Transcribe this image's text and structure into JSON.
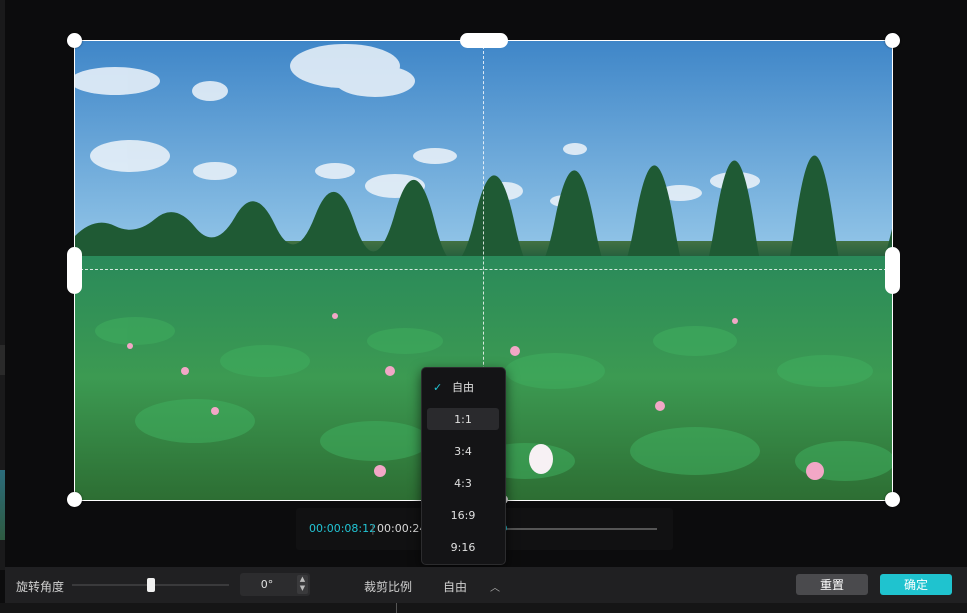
{
  "player": {
    "current_time": "00:00:08:12",
    "separator": "|",
    "total_time": "00:00:24:",
    "progress": 0.34
  },
  "ratio_menu": {
    "items": [
      {
        "label": "自由",
        "selected": true
      },
      {
        "label": "1:1",
        "highlighted": true
      },
      {
        "label": "3:4"
      },
      {
        "label": "4:3"
      },
      {
        "label": "16:9"
      },
      {
        "label": "9:16"
      }
    ]
  },
  "bottom_bar": {
    "rotation_label": "旋转角度",
    "rotation_value": "0°",
    "rotation_level": 0.5,
    "crop_ratio_label": "裁剪比例",
    "crop_ratio_value": "自由",
    "reset_label": "重置",
    "confirm_label": "确定"
  },
  "colors": {
    "accent": "#1fc3cf",
    "background": "#0c0c0d",
    "bar": "#202022"
  },
  "icons": {
    "check": "check-icon",
    "dropdown": "chevron-up-icon",
    "spinner": "spinner-arrows-icon"
  }
}
